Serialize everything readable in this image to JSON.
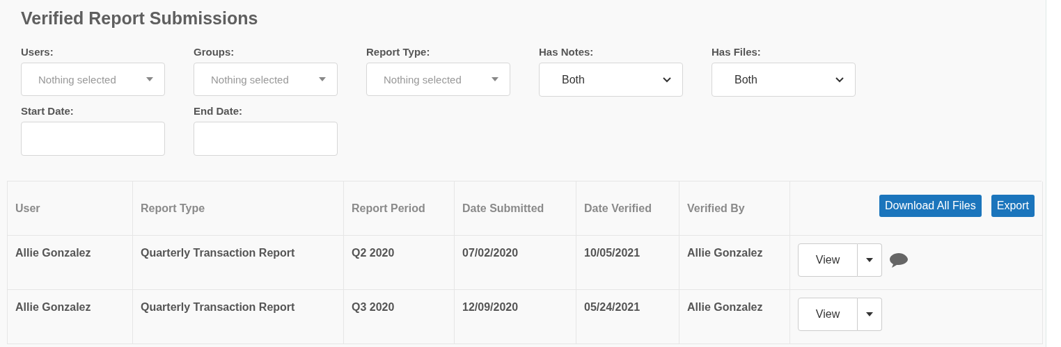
{
  "title": "Verified Report Submissions",
  "filters": [
    {
      "label": "Users:",
      "kind": "multiselect",
      "placeholder": "Nothing selected"
    },
    {
      "label": "Groups:",
      "kind": "multiselect",
      "placeholder": "Nothing selected"
    },
    {
      "label": "Report Type:",
      "kind": "multiselect",
      "placeholder": "Nothing selected"
    },
    {
      "label": "Has Notes:",
      "kind": "select",
      "value": "Both"
    },
    {
      "label": "Has Files:",
      "kind": "select",
      "value": "Both"
    },
    {
      "label": "Start Date:",
      "kind": "date"
    },
    {
      "label": "End Date:",
      "kind": "date"
    }
  ],
  "table": {
    "columns": [
      "User",
      "Report Type",
      "Report Period",
      "Date Submitted",
      "Date Verified",
      "Verified By"
    ],
    "header_buttons": [
      "Download All Files",
      "Export"
    ],
    "rows": [
      {
        "cells": [
          "Allie Gonzalez",
          "Quarterly Transaction Report",
          "Q2 2020",
          "07/02/2020",
          "10/05/2021",
          "Allie Gonzalez"
        ],
        "action": "View",
        "has_notes": true
      },
      {
        "cells": [
          "Allie Gonzalez",
          "Quarterly Transaction Report",
          "Q3 2020",
          "12/09/2020",
          "05/24/2021",
          "Allie Gonzalez"
        ],
        "action": "View",
        "has_notes": false
      }
    ]
  }
}
